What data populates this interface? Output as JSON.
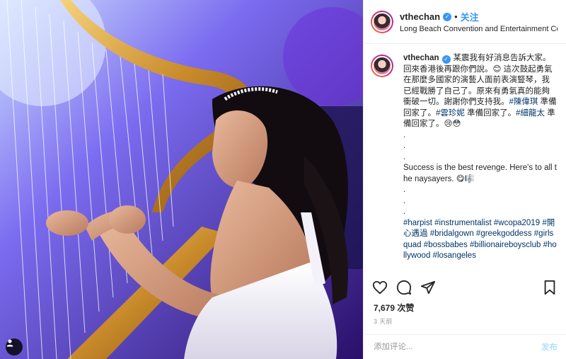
{
  "post": {
    "username": "vthechan",
    "follow_label": "关注",
    "dot": "•",
    "location": "Long Beach Convention and Entertainment Ce...",
    "verified_mark": "✓"
  },
  "caption": {
    "username": "vthechan",
    "line1": "某震我有好消息告訴大家。回來香港後再跟你們說。😊 這次鼓起勇氣在那麼多國家的演藝人面前表演豎琴，我已經戰勝了自己了。原來有勇氣真的能夠衝破一切。謝謝你們支持我。",
    "mention1": "#陳偉琪",
    "text2": " 準備回家了。",
    "mention2": "#雲珍妮",
    "text3": " 準備回家了。",
    "mention3": "#細龍太",
    "text4": " 準備回家了。😢😳",
    "dots1": [
      ".",
      ".",
      "."
    ],
    "english": "Success is the best revenge. Here's to all the naysayers. 😋🎼",
    "dots2": [
      ".",
      ".",
      "."
    ],
    "hashtags": [
      "#harpist",
      "#instrumentalist",
      "#wcopa2019",
      "#開心遇過",
      "#bridalgown",
      "#greekgoddess",
      "#girlsquad",
      "#bossbabes",
      "#billionaireboysclub",
      "#hollywood",
      "#losangeles"
    ]
  },
  "actions": {
    "icons": [
      "heart-icon",
      "comment-icon",
      "share-icon",
      "bookmark-icon"
    ]
  },
  "likes": "7,679 次赞",
  "date": "3 天前",
  "comment_box": {
    "placeholder": "添加评论...",
    "post_label": "发布"
  },
  "colors": {
    "link": "#3897f0",
    "hashtag": "#003569",
    "muted": "#999999",
    "border": "#efefef"
  }
}
